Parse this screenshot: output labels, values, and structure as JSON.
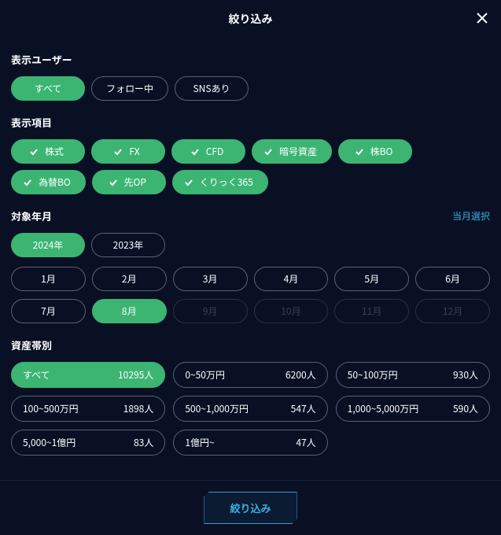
{
  "header": {
    "title": "絞り込み"
  },
  "users": {
    "title": "表示ユーザー",
    "options": [
      {
        "label": "すべて",
        "active": true
      },
      {
        "label": "フォロー中",
        "active": false
      },
      {
        "label": "SNSあり",
        "active": false
      }
    ]
  },
  "items": {
    "title": "表示項目",
    "options": [
      {
        "label": "株式",
        "active": true
      },
      {
        "label": "FX",
        "active": true
      },
      {
        "label": "CFD",
        "active": true
      },
      {
        "label": "暗号資産",
        "active": true
      },
      {
        "label": "株BO",
        "active": true
      },
      {
        "label": "為替BO",
        "active": true
      },
      {
        "label": "先OP",
        "active": true
      },
      {
        "label": "くりっく365",
        "active": true
      }
    ]
  },
  "period": {
    "title": "対象年月",
    "currentMonthLink": "当月選択",
    "years": [
      {
        "label": "2024年",
        "active": true
      },
      {
        "label": "2023年",
        "active": false
      }
    ],
    "months": [
      {
        "label": "1月",
        "state": "normal"
      },
      {
        "label": "2月",
        "state": "normal"
      },
      {
        "label": "3月",
        "state": "normal"
      },
      {
        "label": "4月",
        "state": "normal"
      },
      {
        "label": "5月",
        "state": "normal"
      },
      {
        "label": "6月",
        "state": "normal"
      },
      {
        "label": "7月",
        "state": "normal"
      },
      {
        "label": "8月",
        "state": "active"
      },
      {
        "label": "9月",
        "state": "disabled"
      },
      {
        "label": "10月",
        "state": "disabled"
      },
      {
        "label": "11月",
        "state": "disabled"
      },
      {
        "label": "12月",
        "state": "disabled"
      }
    ]
  },
  "assets": {
    "title": "資産帯別",
    "options": [
      {
        "label": "すべて",
        "count": "10295人",
        "active": true
      },
      {
        "label": "0~50万円",
        "count": "6200人",
        "active": false
      },
      {
        "label": "50~100万円",
        "count": "930人",
        "active": false
      },
      {
        "label": "100~500万円",
        "count": "1898人",
        "active": false
      },
      {
        "label": "500~1,000万円",
        "count": "547人",
        "active": false
      },
      {
        "label": "1,000~5,000万円",
        "count": "590人",
        "active": false
      },
      {
        "label": "5,000~1億円",
        "count": "83人",
        "active": false
      },
      {
        "label": "1億円~",
        "count": "47人",
        "active": false
      }
    ]
  },
  "footer": {
    "submit": "絞り込み"
  }
}
